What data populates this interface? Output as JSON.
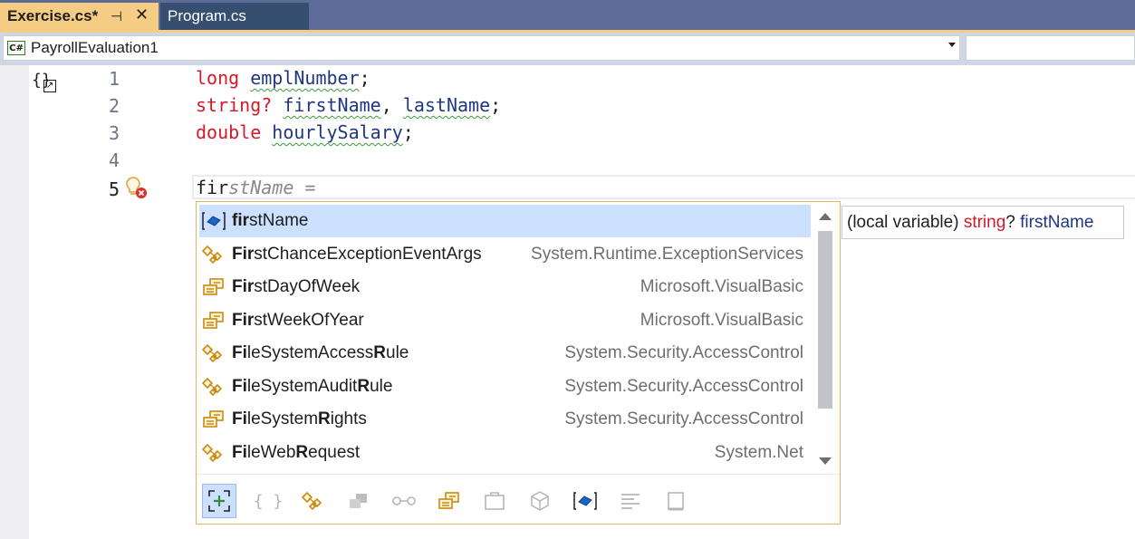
{
  "tabs": [
    {
      "label": "Exercise.cs*",
      "active": true,
      "pin_icon": "pin-icon",
      "close_icon": "close-icon"
    },
    {
      "label": "Program.cs",
      "active": false
    }
  ],
  "navbar": {
    "project_icon_label": "C#",
    "project_name": "PayrollEvaluation1"
  },
  "editor": {
    "line_numbers": [
      "1",
      "2",
      "3",
      "4",
      "5"
    ],
    "lines": {
      "l1": {
        "kw": "long",
        "sp": " ",
        "id": "emplNumber",
        "end": ";"
      },
      "l2": {
        "kw": "string?",
        "sp": " ",
        "id1": "firstName",
        "mid": ", ",
        "id2": "lastName",
        "end": ";"
      },
      "l3": {
        "kw": "double",
        "sp": " ",
        "id": "hourlySalary",
        "end": ";"
      },
      "l5": {
        "typed": "fir",
        "ghost": "stName ="
      }
    }
  },
  "completion": {
    "items": [
      {
        "icon": "local-variable-icon",
        "match": "fir",
        "rest": "stName",
        "ns": "",
        "selected": true
      },
      {
        "icon": "class-icon",
        "match": "Fir",
        "rest": "stChanceExceptionEventArgs",
        "ns": "System.Runtime.ExceptionServices"
      },
      {
        "icon": "enum-icon",
        "match": "Fir",
        "rest": "stDayOfWeek",
        "ns": "Microsoft.VisualBasic"
      },
      {
        "icon": "enum-icon",
        "match": "Fir",
        "rest": "stWeekOfYear",
        "ns": "Microsoft.VisualBasic"
      },
      {
        "icon": "class-icon",
        "parts": [
          "Fi",
          "leSystemAccess",
          "R",
          "ule"
        ],
        "ns": "System.Security.AccessControl"
      },
      {
        "icon": "class-icon",
        "parts": [
          "Fi",
          "leSystemAudit",
          "R",
          "ule"
        ],
        "ns": "System.Security.AccessControl"
      },
      {
        "icon": "enum-icon",
        "parts": [
          "Fi",
          "leSystem",
          "R",
          "ights"
        ],
        "ns": "System.Security.AccessControl"
      },
      {
        "icon": "class-icon",
        "parts": [
          "Fi",
          "leWeb",
          "R",
          "equest"
        ],
        "ns": "System.Net"
      }
    ],
    "filters": [
      "expander-icon",
      "namespace-icon",
      "class-icon",
      "struct-icon",
      "interface-icon",
      "enum-icon",
      "delegate-icon",
      "module-icon",
      "local-variable-icon",
      "snippet-icon",
      "target-type-icon"
    ]
  },
  "tooltip": {
    "prefix": "(local variable) ",
    "type": "string",
    "q": "?",
    "name": " firstName"
  },
  "colors": {
    "keyword": "#d11b2b",
    "identifier": "#1f377f",
    "selection": "#cce0ff",
    "active_tab": "#f5cc84",
    "tabbar": "#5d6b99"
  }
}
